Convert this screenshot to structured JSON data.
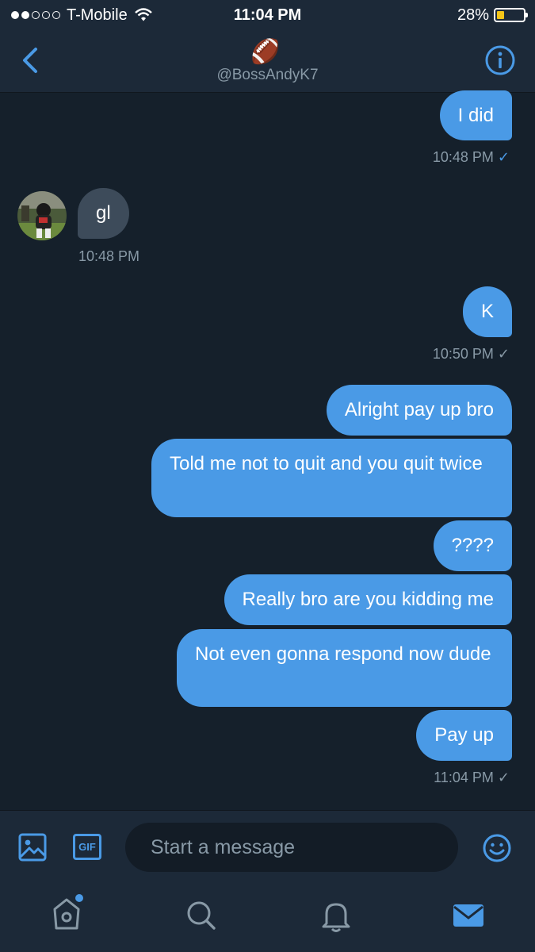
{
  "status": {
    "carrier": "T-Mobile",
    "time": "11:04 PM",
    "battery": "28%",
    "battery_level": 0.28
  },
  "header": {
    "emoji": "🏈",
    "handle": "@BossAndyK7"
  },
  "messages": [
    {
      "text": "I did",
      "time": "10:48 PM",
      "direction": "out",
      "read_check": "✓"
    },
    {
      "text": "gl",
      "time": "10:48 PM",
      "direction": "in"
    },
    {
      "text": "K",
      "time": "10:50 PM",
      "direction": "out",
      "read_check": "✓"
    },
    {
      "text": "Alright pay up bro",
      "direction": "out"
    },
    {
      "text": "Told me not to quit and you quit twice",
      "direction": "out"
    },
    {
      "text": "????",
      "direction": "out"
    },
    {
      "text": "Really bro are you kidding me",
      "direction": "out"
    },
    {
      "text": "Not even gonna respond now dude",
      "direction": "out"
    },
    {
      "text": "Pay up",
      "time": "11:04 PM",
      "direction": "out",
      "read_check": "✓"
    }
  ],
  "composer": {
    "placeholder": "Start a message",
    "gif_label": "GIF"
  },
  "tabs": [
    "home",
    "search",
    "notifications",
    "messages"
  ],
  "colors": {
    "accent": "#4a9ae6",
    "background": "#15202b",
    "bar": "#1c2938"
  }
}
